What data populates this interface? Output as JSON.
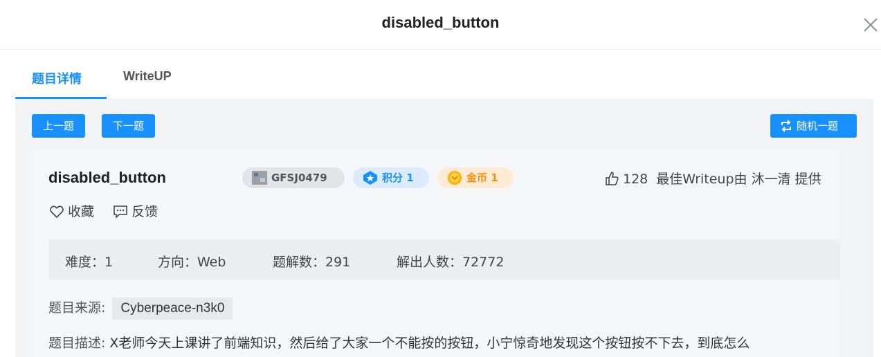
{
  "modal": {
    "title": "disabled_button"
  },
  "tabs": [
    {
      "label": "题目详情",
      "active": true
    },
    {
      "label": "WriteUP",
      "active": false
    }
  ],
  "toolbar": {
    "prev_label": "上一题",
    "next_label": "下一题",
    "random_label": "随机一题"
  },
  "challenge": {
    "name": "disabled_button",
    "id_tag": "GFSJ0479",
    "score_tag": "积分 1",
    "gold_tag": "金币 1",
    "likes": "128",
    "best_writeup": "最佳Writeup由 沐一清 提供",
    "favorite_label": "收藏",
    "feedback_label": "反馈"
  },
  "stats": {
    "difficulty": "难度：1",
    "direction": "方向：Web",
    "solutions": "题解数：291",
    "solvers": "解出人数：72772"
  },
  "source": {
    "label": "题目来源:",
    "value": "Cyberpeace-n3k0"
  },
  "description": {
    "label": "题目描述:",
    "text": "X老师今天上课讲了前端知识，然后给了大家一个不能按的按钮，小宁惊奇地发现这个按钮按不下去，到底怎么"
  },
  "colors": {
    "accent": "#1890ff",
    "gold": "#ff8a00",
    "panel": "#f1f3f5"
  }
}
